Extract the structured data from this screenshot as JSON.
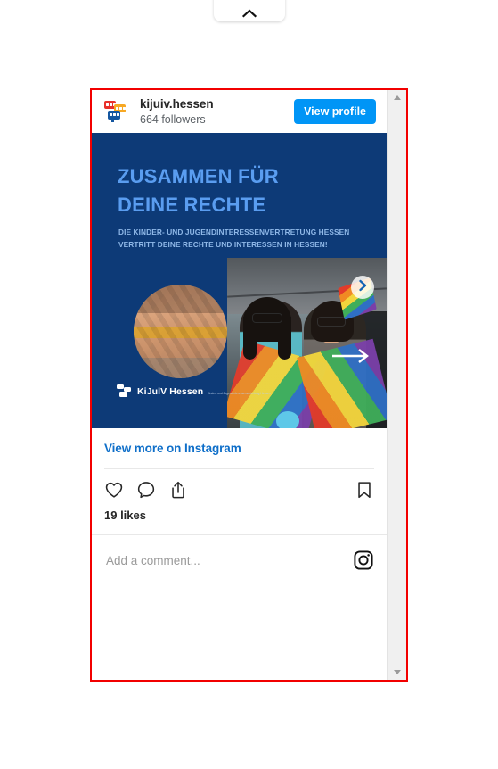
{
  "page": {
    "background_color": "#ffffff",
    "collapse_button": {
      "icon": "chevron-up-icon",
      "label": ""
    }
  },
  "embed": {
    "border_color": "#f20000",
    "accent_color": "#0095f6",
    "link_color": "#0f6fc9",
    "header": {
      "avatar_icon": "speech-bubbles-avatar-icon",
      "username": "kijuiv.hessen",
      "followers": "664 followers",
      "view_profile_label": "View profile"
    },
    "media": {
      "background_color": "#0d3a77",
      "headline_line1": "ZUSAMMEN FÜR",
      "headline_line2": "DEINE RECHTE",
      "subtitle_line1": "DIE KINDER- UND JUGENDINTERESSENVERTRETUNG HESSEN",
      "subtitle_line2": "VERTRITT DEINE RECHTE UND INTERESSEN IN HESSEN!",
      "logo_name": "KiJulV Hessen",
      "logo_subtitle": "Kinder- und Jugendinteressenvertretung Hessen",
      "carousel_next_icon": "chevron-right-icon",
      "overlay_arrow_icon": "arrow-right-icon"
    },
    "body": {
      "view_more_label": "View more on Instagram",
      "like_icon": "heart-icon",
      "comment_icon": "comment-bubble-icon",
      "share_icon": "share-icon",
      "save_icon": "bookmark-icon",
      "likes_text": "19 likes"
    },
    "comment": {
      "value": "",
      "placeholder": "Add a comment...",
      "brand_icon": "instagram-icon"
    },
    "scrollbar": {
      "up_icon": "scroll-up-arrow-icon",
      "down_icon": "scroll-down-arrow-icon"
    }
  }
}
